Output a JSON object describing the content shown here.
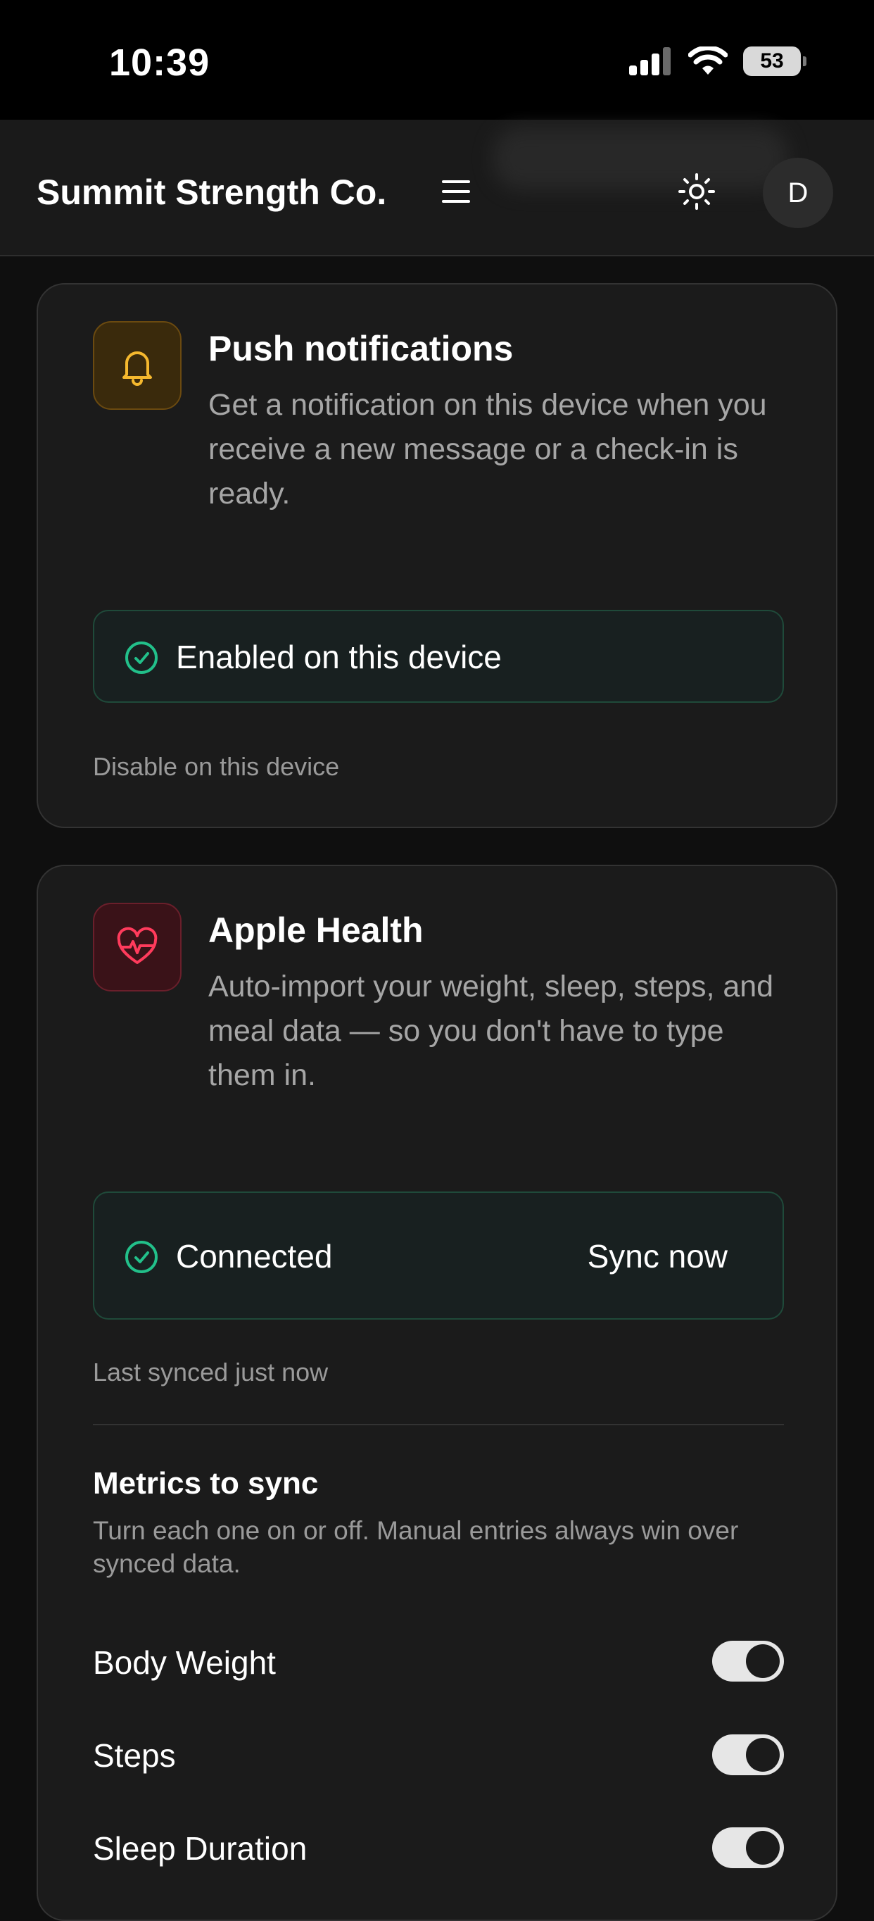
{
  "status_bar": {
    "time": "10:39",
    "battery": "53"
  },
  "header": {
    "brand": "Summit Strength Co.",
    "avatar_initial": "D"
  },
  "push_card": {
    "title": "Push notifications",
    "description": "Get a notification on this device when you receive a new message or a check-in is ready.",
    "status": "Enabled on this device",
    "disable_link": "Disable on this device",
    "icon": "bell-icon",
    "accent": "#f5b82e"
  },
  "health_card": {
    "title": "Apple Health",
    "description": "Auto-import your weight, sleep, steps, and meal data — so you don't have to type them in.",
    "status": "Connected",
    "sync_label": "Sync now",
    "last_synced": "Last synced just now",
    "icon": "heart-pulse-icon",
    "accent": "#ff3b5c",
    "metrics_title": "Metrics to sync",
    "metrics_desc": "Turn each one on or off. Manual entries always win over synced data.",
    "metrics": [
      {
        "label": "Body Weight",
        "enabled": true
      },
      {
        "label": "Steps",
        "enabled": true
      },
      {
        "label": "Sleep Duration",
        "enabled": true
      }
    ]
  },
  "colors": {
    "success": "#22c08a"
  }
}
